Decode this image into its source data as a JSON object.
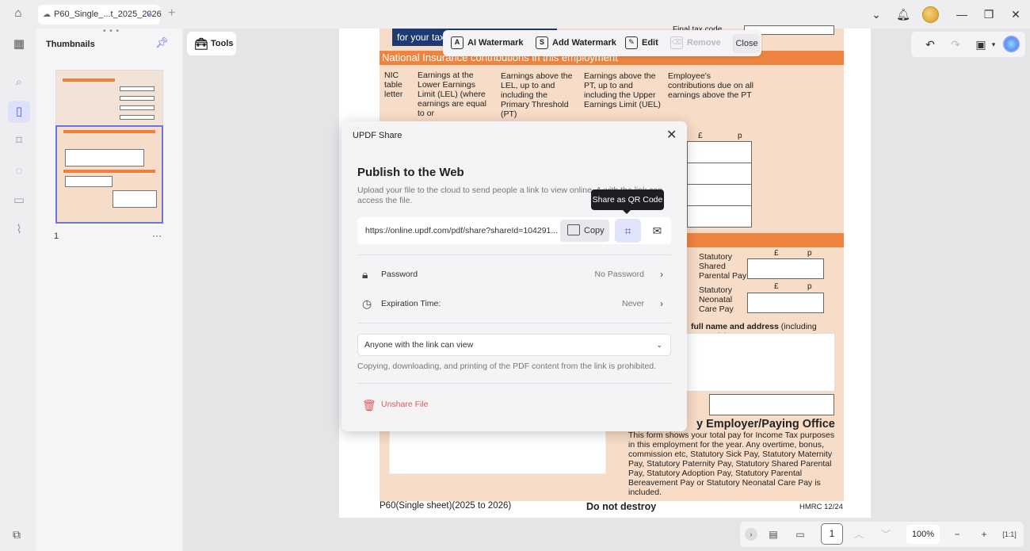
{
  "titlebar": {
    "tab_label": "P60_Single_...t_2025_2026",
    "avatar_icon": "user-avatar"
  },
  "thumbnails": {
    "title": "Thumbnails",
    "page_number": "1",
    "more": "···"
  },
  "tools": {
    "label": "Tools"
  },
  "pdf_toolbar": {
    "ai_watermark": "AI Watermark",
    "add_watermark": "Add Watermark",
    "edit": "Edit",
    "remove": "Remove",
    "close": "Close"
  },
  "document": {
    "navy_text": "for your tax",
    "final_tax_code": "Final tax code",
    "section_ni": "National Insurance contributions in this employment",
    "col_nic": "NIC table letter",
    "col_lel": "Earnings at the Lower Earnings Limit (LEL) (where earnings are equal to or",
    "col_pt": "Earnings above the LEL, up to and including the Primary Threshold (PT)",
    "col_uel": "Earnings above the PT, up to and including the Upper Earnings Limit (UEL)",
    "col_emp": "Employee's contributions due on all earnings above the PT",
    "pound": "£",
    "pence": "p",
    "statutory_shared": "Statutory Shared Parental Pay",
    "statutory_neonatal": "Statutory Neonatal Care Pay",
    "full_name": "full name and address",
    "incl_postcode": "(including postcode)",
    "employer_heading": "y Employer/Paying Office",
    "employer_text": "This form shows your total pay for Income Tax purposes in this employment for the year. Any overtime, bonus, commission etc, Statutory Sick Pay, Statutory Maternity Pay, Statutory Paternity Pay, Statutory Shared Parental Pay, Statutory Adoption Pay, Statutory Parental Bereavement Pay or Statutory Neonatal Care Pay is included.",
    "footer_left": "P60(Single sheet)(2025 to 2026)",
    "footer_mid": "Do not destroy",
    "footer_right": "HMRC 12/24"
  },
  "bottom_bar": {
    "page_input": "1",
    "zoom": "100%"
  },
  "share_dialog": {
    "title": "UPDF Share",
    "heading": "Publish to the Web",
    "description": "Upload your file to the cloud to send people a link to view online. A          with the link can access the file.",
    "link": "https://online.updf.com/pdf/share?shareId=104291...",
    "copy_label": "Copy",
    "tooltip": "Share as QR Code",
    "password_label": "Password",
    "password_value": "No Password",
    "expiration_label": "Expiration Time:",
    "expiration_value": "Never",
    "access_select": "Anyone with the link can view",
    "note": "Copying, downloading, and printing of the PDF content from the link is prohibited.",
    "unshare_label": "Unshare File"
  },
  "colors": {
    "accent": "#4f5bd5",
    "form_orange": "#ef8440",
    "form_peach": "#f7dcc7",
    "danger": "#e05a5a"
  }
}
